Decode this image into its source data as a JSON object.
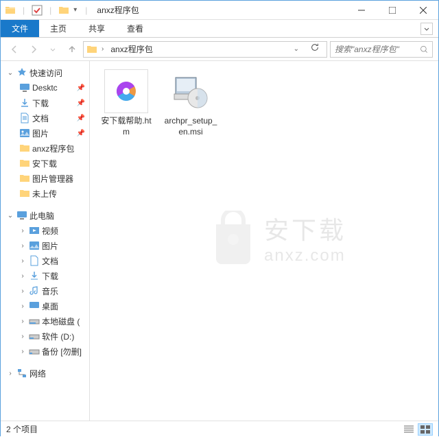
{
  "window": {
    "title": "anxz程序包"
  },
  "ribbon": {
    "file": "文件",
    "home": "主页",
    "share": "共享",
    "view": "查看"
  },
  "nav": {
    "breadcrumb": "anxz程序包",
    "search_placeholder": "搜索\"anxz程序包\""
  },
  "sidebar": {
    "quick_access": "快速访问",
    "desktop": "Desktc",
    "downloads": "下载",
    "documents": "文档",
    "pictures": "图片",
    "anxz_pkg": "anxz程序包",
    "an_download": "安下载",
    "pic_mgr": "图片管理器",
    "not_up": "未上传",
    "this_pc": "此电脑",
    "video": "视频",
    "pics2": "图片",
    "docs2": "文档",
    "dl2": "下载",
    "music": "音乐",
    "desk2": "桌面",
    "localdisk": "本地磁盘 (",
    "soft_d": "软件 (D:)",
    "backup": "备份 [勿删]",
    "network": "网络"
  },
  "files": [
    {
      "name": "安下载帮助.htm"
    },
    {
      "name": "archpr_setup_en.msi"
    }
  ],
  "status": {
    "count": "2 个项目"
  },
  "watermark": {
    "cn": "安下载",
    "en": "anxz.com"
  }
}
